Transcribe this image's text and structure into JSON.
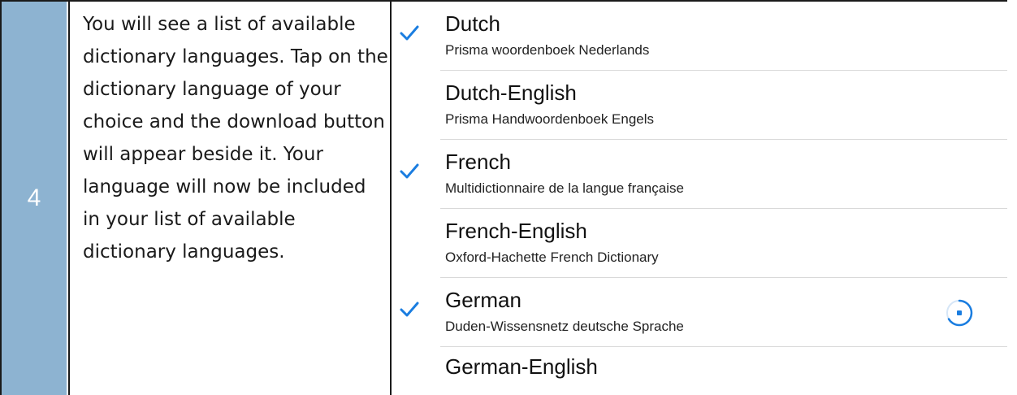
{
  "step": {
    "number": "4",
    "instruction": "You will see a list of available dictionary languages. Tap on the dictionary language of your choice and the download button will appear beside it. Your language will now be included in your list of available dictionary languages."
  },
  "languages": [
    {
      "name": "Dutch",
      "dictionary": "Prisma woordenboek Nederlands",
      "checked": true
    },
    {
      "name": "Dutch-English",
      "dictionary": "Prisma Handwoordenboek Engels",
      "checked": false
    },
    {
      "name": "French",
      "dictionary": "Multidictionnaire de la langue française",
      "checked": true
    },
    {
      "name": "French-English",
      "dictionary": "Oxford-Hachette French Dictionary",
      "checked": false
    },
    {
      "name": "German",
      "dictionary": "Duden-Wissensnetz deutsche Sprache",
      "checked": true,
      "downloading": true
    },
    {
      "name": "German-English",
      "dictionary": "",
      "checked": false
    }
  ],
  "colors": {
    "step_cell_bg": "#8db3d1",
    "check_blue": "#1a7de0",
    "border": "#1a1a1a",
    "separator": "#d9d9d9"
  },
  "icons": {
    "check": "check-icon",
    "download": "download-progress-icon"
  }
}
